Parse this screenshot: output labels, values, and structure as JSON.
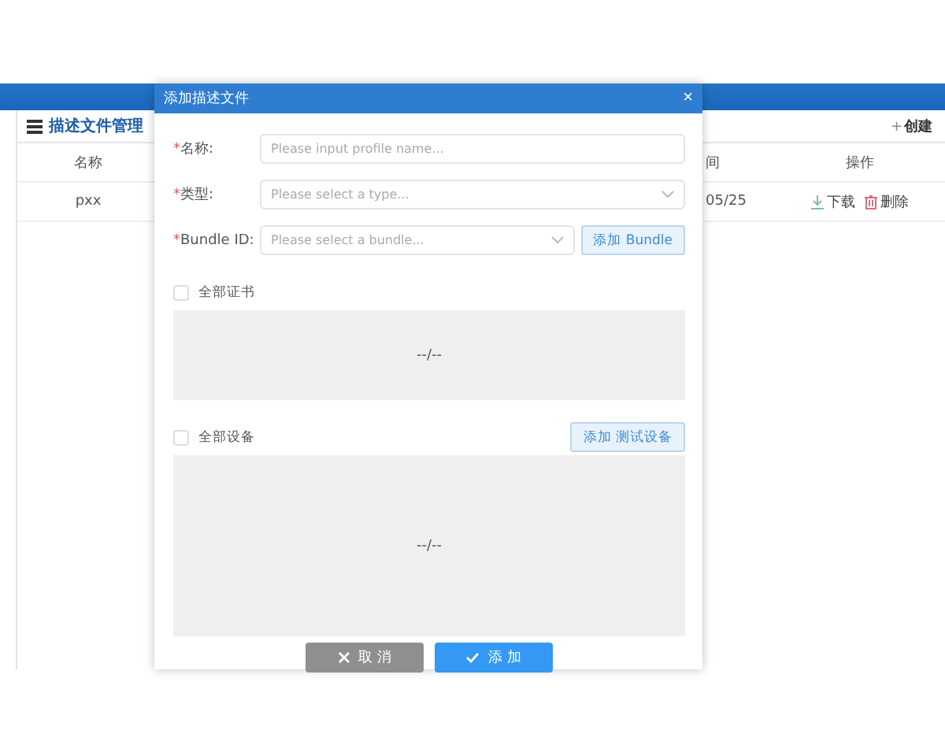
{
  "page": {
    "title": "描述文件管理",
    "create_icon": "+",
    "create_button": "创建",
    "table": {
      "columns": [
        "名称",
        "间",
        "操作"
      ],
      "rows": [
        {
          "cells": [
            "pxx",
            "05/25"
          ],
          "actions": [
            {
              "kind": "download",
              "label": "下载"
            },
            {
              "kind": "delete",
              "label": "删除"
            }
          ]
        }
      ]
    }
  },
  "dialog": {
    "title": "添加描述文件",
    "close": "×",
    "fields": [
      {
        "kind": "input",
        "label": "名称:",
        "required_mark": "*",
        "placeholder": "Please input profile name..."
      },
      {
        "kind": "select",
        "label": "类型:",
        "required_mark": "*",
        "placeholder": "Please select a type..."
      },
      {
        "kind": "select",
        "label": "Bundle ID:",
        "required_mark": "*",
        "placeholder": "Please select a bundle...",
        "button": "添加 Bundle"
      }
    ],
    "sections": [
      {
        "label": "全部证书",
        "checked": false,
        "empty_text": "--/--"
      },
      {
        "label": "全部设备",
        "checked": false,
        "button": "添加 测试设备",
        "empty_text": "--/--"
      }
    ],
    "buttons": [
      {
        "kind": "cancel",
        "label": "取 消"
      },
      {
        "kind": "confirm",
        "label": "添 加"
      }
    ]
  }
}
